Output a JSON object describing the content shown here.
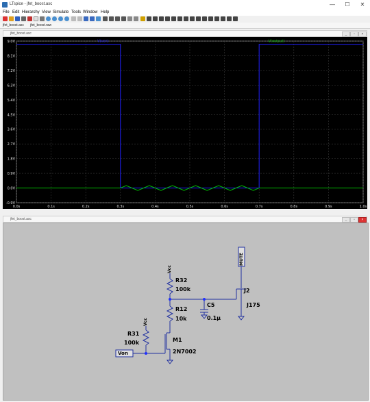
{
  "window": {
    "title": "LTspice - jfet_boost.asc",
    "minimize": "—",
    "maximize": "☐",
    "close": "✕"
  },
  "menu": [
    "File",
    "Edit",
    "Hierarchy",
    "View",
    "Simulate",
    "Tools",
    "Window",
    "Help"
  ],
  "doc_tabs": [
    "jfet_boost.asc",
    "jfet_boost.raw"
  ],
  "plot_window": {
    "title": "jfet_boost.asc",
    "traces": [
      {
        "label": "V(von)",
        "color": "#2020ff"
      },
      {
        "label": "V(output)",
        "color": "#00c000"
      }
    ]
  },
  "schematic_window": {
    "title": "jfet_boost.asc",
    "labels": {
      "mute": "MUTE",
      "vcc1": "Vcc",
      "vcc2": "Vcc",
      "r32_name": "R32",
      "r32_val": "100k",
      "r12_name": "R12",
      "r12_val": "10k",
      "r31_name": "R31",
      "r31_val": "100k",
      "c5_name": "C5",
      "c5_val": "0.1µ",
      "j2_name": "J2",
      "j2_val": "J175",
      "m1_name": "M1",
      "m1_val": "2N7002",
      "von": "Von"
    }
  },
  "chart_data": {
    "type": "line",
    "title": "",
    "xlabel": "",
    "ylabel": "",
    "x_ticks": [
      "0.0s",
      "0.1s",
      "0.2s",
      "0.3s",
      "0.4s",
      "0.5s",
      "0.6s",
      "0.7s",
      "0.8s",
      "0.9s",
      "1.0s"
    ],
    "y_ticks": [
      "9.0V",
      "8.1V",
      "7.2V",
      "6.3V",
      "5.4V",
      "4.5V",
      "3.6V",
      "2.7V",
      "1.8V",
      "0.9V",
      "0.0V",
      "-0.9V"
    ],
    "xlim": [
      0,
      1.0
    ],
    "ylim": [
      -0.9,
      9.0
    ],
    "grid": true,
    "series": [
      {
        "name": "V(von)",
        "color": "#2020ff",
        "x": [
          0,
          0.3,
          0.3,
          0.7,
          0.7,
          1.0
        ],
        "y": [
          8.8,
          8.8,
          0.0,
          0.0,
          8.8,
          8.8
        ]
      },
      {
        "name": "V(output)",
        "color": "#00c000",
        "x": [
          0,
          0.3,
          0.3,
          0.3167,
          0.3333,
          0.35,
          0.3667,
          0.3833,
          0.4,
          0.4167,
          0.4333,
          0.45,
          0.4667,
          0.4833,
          0.5,
          0.5167,
          0.5333,
          0.55,
          0.5667,
          0.5833,
          0.6,
          0.6167,
          0.6333,
          0.65,
          0.6667,
          0.6833,
          0.7,
          0.7,
          1.0
        ],
        "y": [
          0.0,
          0.0,
          0.0,
          0.15,
          0.0,
          -0.15,
          0.0,
          0.15,
          0.0,
          -0.15,
          0.0,
          0.15,
          0.0,
          -0.15,
          0.0,
          0.15,
          0.0,
          -0.15,
          0.0,
          0.15,
          0.0,
          -0.15,
          0.0,
          0.15,
          0.0,
          -0.15,
          0.0,
          0.0,
          0.0
        ]
      }
    ]
  }
}
